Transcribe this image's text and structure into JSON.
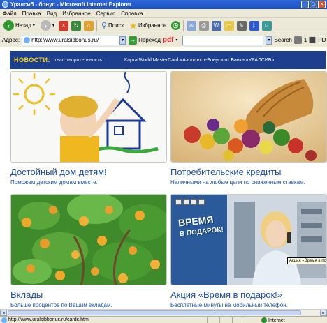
{
  "window": {
    "title": "Уралсиб - бонус - Microsoft Internet Explorer",
    "minimize": "_",
    "maximize": "□",
    "close": "×"
  },
  "menu": [
    "Файл",
    "Правка",
    "Вид",
    "Избранное",
    "Сервис",
    "Справка"
  ],
  "toolbar": {
    "back_label": "Назад",
    "search_label": "Поиск",
    "favorites_label": "Избранное"
  },
  "address": {
    "label": "Адрес:",
    "url": "http://www.uralsibbonus.ru/",
    "go_label": "Переход",
    "pdf_label": "pdf",
    "search_label": "Search",
    "extra1": "1",
    "extra2": "PD"
  },
  "news": {
    "label": "НОВОСТИ:",
    "text1": "тваготворительность.",
    "text2": "Карта World MasterCard «Аэрофлот-Бонус» от Банка «УРАЛСИБ»."
  },
  "cards": [
    {
      "title": "Достойный дом детям!",
      "subtitle": "Поможем детским домам вместе."
    },
    {
      "title": "Потребительские кредиты",
      "subtitle": "Наличными на любые цели по сниженным ставкам."
    },
    {
      "title": "Вклады",
      "subtitle": "Больше процентов по Вашим вкладам."
    },
    {
      "title": "Акция «Время в подарок!»",
      "subtitle": "Бесплатные минуты на мобильный телефон."
    }
  ],
  "promo": {
    "line1": "ВРЕМЯ",
    "line2": "В ПОДАРОК!",
    "tooltip": "Акция «Время в по"
  },
  "status": {
    "url": "http://www.uralsibbonus.ru/cards.html",
    "zone": "Internet"
  },
  "colors": {
    "news_bg": "#1d3f8e",
    "news_label": "#ffd200",
    "link_blue": "#1d4fa6"
  }
}
